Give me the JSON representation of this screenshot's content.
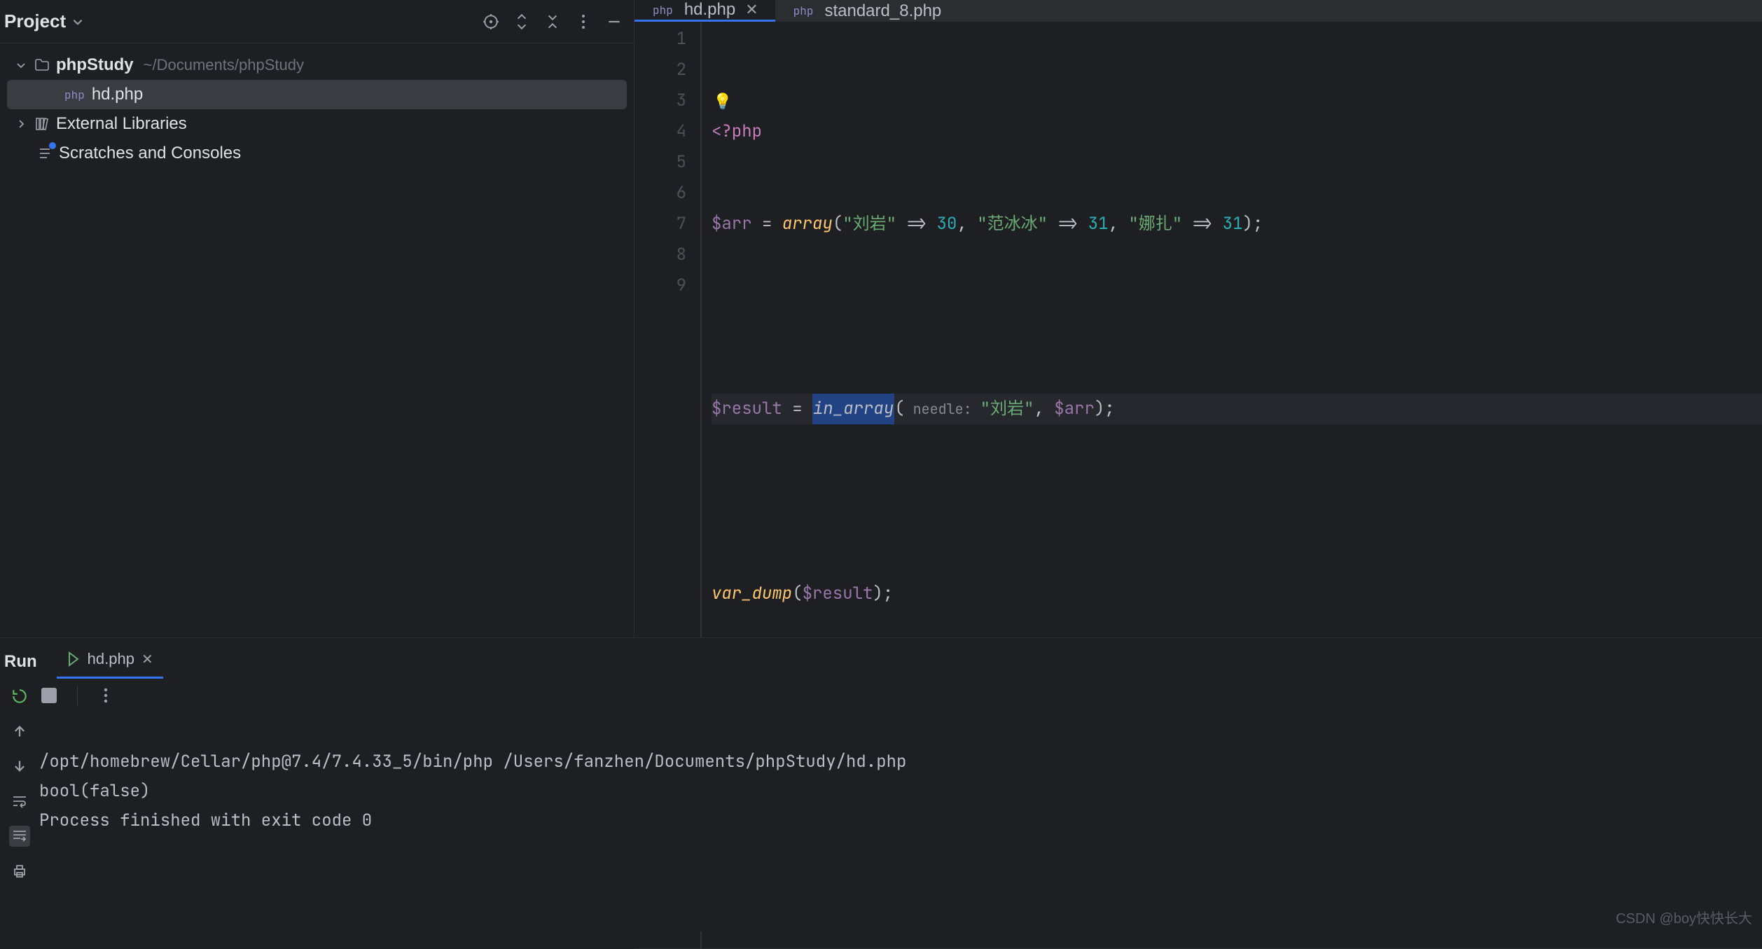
{
  "sidebar": {
    "title": "Project",
    "project_name": "phpStudy",
    "project_path": "~/Documents/phpStudy",
    "file": "hd.php",
    "external_libs": "External Libraries",
    "scratches": "Scratches and Consoles"
  },
  "tabs": [
    {
      "label": "hd.php",
      "active": true
    },
    {
      "label": "standard_8.php",
      "active": false
    }
  ],
  "php_badge": "php",
  "code": {
    "line_numbers": [
      "1",
      "2",
      "3",
      "4",
      "5",
      "6",
      "7",
      "8",
      "9"
    ],
    "l1_open": "<?php",
    "l2": {
      "var": "$arr",
      "eq": " = ",
      "fn": "array",
      "open": "(",
      "k1": "\"刘岩\"",
      "arrow1": " => ",
      "v1": "30",
      "c1": ", ",
      "k2": "\"范冰冰\"",
      "arrow2": " => ",
      "v2": "31",
      "c2": ", ",
      "k3": "\"娜扎\"",
      "arrow3": " => ",
      "v3": "31",
      "close": ");"
    },
    "l4": {
      "var": "$result",
      "eq": " = ",
      "fn": "in_array",
      "open": "(",
      "hint_label": " needle: ",
      "arg1": "\"刘岩\"",
      "c1": ", ",
      "arg2": "$arr",
      "close": ");"
    },
    "l6": {
      "fn": "var_dump",
      "open": "(",
      "arg": "$result",
      "close": ");"
    }
  },
  "run": {
    "title": "Run",
    "tab_label": "hd.php",
    "output_line1": "/opt/homebrew/Cellar/php@7.4/7.4.33_5/bin/php /Users/fanzhen/Documents/phpStudy/hd.php",
    "output_line2": "bool(false)",
    "output_blank": "",
    "output_line3": "Process finished with exit code 0"
  },
  "watermark": "CSDN @boy快快长大"
}
